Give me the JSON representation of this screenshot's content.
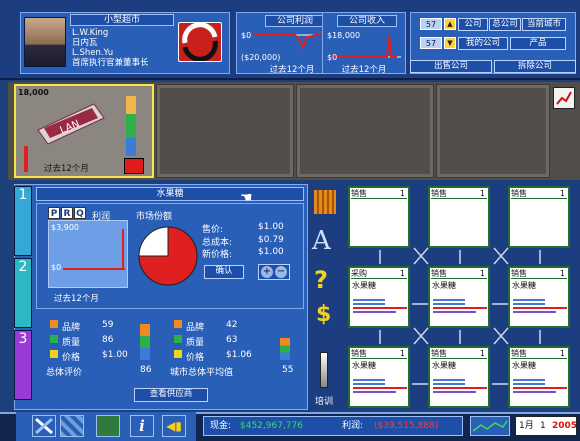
{
  "header": {
    "store_name": "小型超市",
    "manager_line1": "L.W.King",
    "manager_line2": "日内瓦",
    "manager_line3": "L.Shen.Yu",
    "manager_line4": "首席执行官兼董事长",
    "profit_title": "公司利润",
    "profit_top": "$0",
    "profit_bottom": "($20,000)",
    "profit_sub": "过去12个月",
    "revenue_title": "公司收入",
    "revenue_top": "$18,000",
    "revenue_bottom": "$0",
    "revenue_sub": "过去12个月",
    "num1": "57",
    "num2": "57",
    "btn_company": "公司",
    "btn_headquarters": "总公司",
    "btn_current_city": "当前城市",
    "btn_my_company": "我的公司",
    "btn_product": "产品",
    "btn_sell_company": "出售公司",
    "btn_demolish_company": "拆除公司"
  },
  "warehouse": {
    "slot1_amount": "18,000",
    "slot1_label": "过去12个月",
    "product_brand": "LAN"
  },
  "product": {
    "title": "水果糖",
    "tab_p": "P",
    "tab_r": "R",
    "tab_q": "Q",
    "profit_label": "利润",
    "share_label": "市场份额",
    "graph_top": "$3,900",
    "graph_bottom": "$0",
    "graph_sub": "过去12个月",
    "price_label": "售价:",
    "price_value": "$1.00",
    "cost_label": "总成本:",
    "cost_value": "$0.79",
    "newprice_label": "新价格:",
    "newprice_value": "$1.00",
    "confirm": "确认",
    "market_share_pct": 75
  },
  "stats": {
    "left": {
      "brand_label": "品牌",
      "brand_value": "59",
      "quality_label": "质量",
      "quality_value": "86",
      "price_label": "价格",
      "price_value": "$1.00",
      "overall_label": "总体评价",
      "overall_value": "86"
    },
    "right": {
      "brand_label": "品牌",
      "brand_value": "42",
      "quality_label": "质量",
      "quality_value": "63",
      "price_label": "价格",
      "price_value": "$1.06",
      "overall_label": "城市总体平均值",
      "overall_value": "55"
    },
    "supplier_btn": "查看供应商",
    "training": "培训",
    "side_tab_1": "1",
    "side_tab_2": "2",
    "side_tab_3": "3"
  },
  "grid": {
    "cells": [
      {
        "title": "销售",
        "num": "1",
        "line2": "",
        "line3": ""
      },
      {
        "title": "销售",
        "num": "1",
        "line2": "",
        "line3": ""
      },
      {
        "title": "销售",
        "num": "1",
        "line2": "",
        "line3": ""
      },
      {
        "title": "采购",
        "num": "1",
        "line2": "水果糖",
        "line3": ""
      },
      {
        "title": "销售",
        "num": "1",
        "line2": "水果糖",
        "line3": ""
      },
      {
        "title": "销售",
        "num": "1",
        "line2": "水果糖",
        "line3": ""
      },
      {
        "title": "销售",
        "num": "1",
        "line2": "水果糖",
        "line3": ""
      },
      {
        "title": "销售",
        "num": "1",
        "line2": "水果糖",
        "line3": ""
      },
      {
        "title": "销售",
        "num": "1",
        "line2": "水果糖",
        "line3": ""
      }
    ]
  },
  "bottom": {
    "cash_label": "现金:",
    "cash_value": "$452,967,776",
    "profit_label": "利润:",
    "profit_value": "($39,515,888)",
    "month": "1月",
    "day": "1",
    "year": "2005"
  },
  "colors": {
    "accent_red": "#e02020",
    "cash_green": "#34e058",
    "profit_red": "#ff3b3b",
    "year_red": "#d81010"
  }
}
